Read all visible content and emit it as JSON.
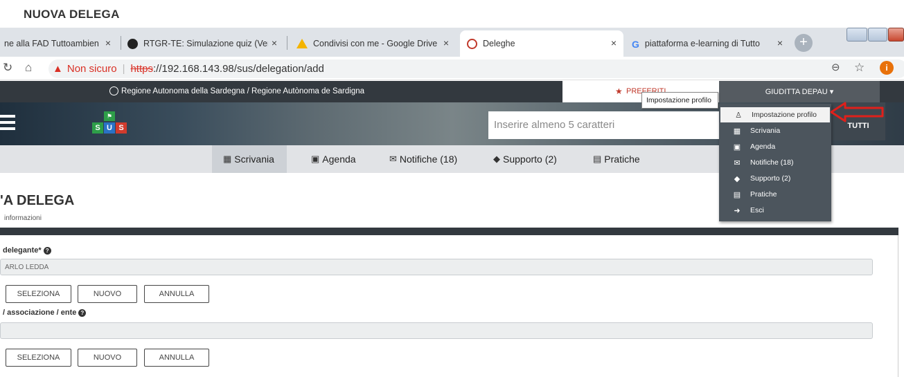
{
  "document_title": "NUOVA DELEGA",
  "browser": {
    "tabs": [
      {
        "title": "ne alla FAD Tuttoambien",
        "close": "×"
      },
      {
        "title": "RTGR-TE: Simulazione quiz (Veri",
        "close": "×"
      },
      {
        "title": "Condivisi con me - Google Drive",
        "close": "×"
      },
      {
        "title": "Deleghe",
        "close": "×"
      },
      {
        "title": "piattaforma e-learning di Tutto",
        "close": "×"
      }
    ],
    "new_tab": "+",
    "address": {
      "warning": "▲",
      "security_label": "Non sicuro",
      "scheme": "https",
      "url_rest": "://192.168.143.98/sus/delegation/add"
    },
    "profile_initial": "i"
  },
  "site": {
    "region": "Regione Autonoma della Sardegna / Regione Autònoma de Sardigna",
    "preferiti": "PREFERITI",
    "user_name": "GIUDITTA DEPAU ▾",
    "logo_letters": [
      "S",
      "U",
      "S"
    ],
    "search_placeholder": "Inserire almeno 5 caratteri",
    "search_scope": "TUTTI",
    "nav": [
      {
        "label": "Scrivania",
        "icon": "grid-icon"
      },
      {
        "label": "Agenda",
        "icon": "calendar-icon"
      },
      {
        "label": "Notifiche (18)",
        "icon": "envelope-icon"
      },
      {
        "label": "Supporto (2)",
        "icon": "tag-icon"
      },
      {
        "label": "Pratiche",
        "icon": "file-icon"
      }
    ]
  },
  "tooltip": "Impostazione profilo",
  "dropdown": {
    "items": [
      {
        "label": "Impostazione profilo",
        "icon": "user-icon"
      },
      {
        "label": "Scrivania",
        "icon": "grid-icon"
      },
      {
        "label": "Agenda",
        "icon": "calendar-icon"
      },
      {
        "label": "Notifiche (18)",
        "icon": "envelope-icon"
      },
      {
        "label": "Supporto (2)",
        "icon": "tag-icon"
      },
      {
        "label": "Pratiche",
        "icon": "file-icon"
      },
      {
        "label": "Esci",
        "icon": "logout-icon"
      }
    ]
  },
  "page": {
    "title": "'A DELEGA",
    "subtitle": "informazioni",
    "field1": {
      "label": "delegante*",
      "value": "ARLO LEDDA"
    },
    "field2": {
      "label": "/ associazione / ente",
      "value": ""
    },
    "buttons": {
      "select": "SELEZIONA",
      "new": "NUOVO",
      "cancel": "ANNULLA"
    }
  },
  "colors": {
    "header_dark": "#33393f",
    "accent_red": "#d93025",
    "dropdown_bg": "#4c555d",
    "sus_green": "#2e9e49",
    "sus_blue": "#2a72c5",
    "sus_red": "#d13b2d"
  }
}
